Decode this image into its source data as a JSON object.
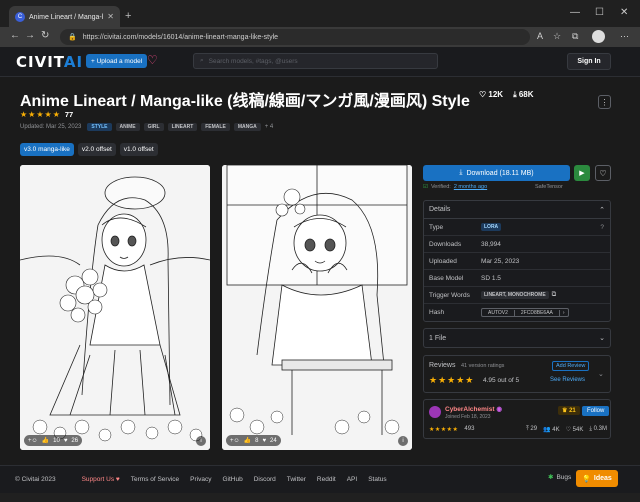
{
  "browser": {
    "tab_title": "Anime Lineart / Manga-like (线稿",
    "url": "https://civitai.com/models/16014/anime-lineart-manga-like-style"
  },
  "site": {
    "logo_main": "CIVIT",
    "logo_ai": "AI",
    "upload_label": "+ Upload a model",
    "search_placeholder": "Search models, #tags, @users",
    "signin_label": "Sign In"
  },
  "model": {
    "title": "Anime Lineart / Manga-like (线稿/線画/マンガ風/漫画风) Style",
    "likes": "12K",
    "downloads_top": "68K",
    "rating_stars": "★★★★★",
    "rating_count": "77",
    "updated": "Updated: Mar 25, 2023",
    "tags": [
      "STYLE",
      "ANIME",
      "GIRL",
      "LINEART",
      "FEMALE",
      "MANGA"
    ],
    "tags_more": "+ 4",
    "versions": [
      "v3.0 manga-like",
      "v2.0 offset",
      "v1.0 offset"
    ]
  },
  "images": [
    {
      "reactions_a": "10",
      "reactions_b": "26"
    },
    {
      "reactions_a": "8",
      "reactions_b": "24"
    }
  ],
  "actions": {
    "download_label": "Download (18.11 MB)",
    "verified_prefix": "Verified:",
    "verified_link": "2 months ago",
    "safetensor": "SafeTensor"
  },
  "details": {
    "header": "Details",
    "rows": {
      "type_label": "Type",
      "type_value": "LORA",
      "downloads_label": "Downloads",
      "downloads_value": "38,994",
      "uploaded_label": "Uploaded",
      "uploaded_value": "Mar 25, 2023",
      "base_label": "Base Model",
      "base_value": "SD 1.5",
      "trigger_label": "Trigger Words",
      "trigger_value": "LINEART, MONOCHROME",
      "hash_label": "Hash",
      "hash_algo": "AUTOV2",
      "hash_value": "2FCD8BE6AA"
    }
  },
  "files": {
    "label": "1 File"
  },
  "reviews": {
    "title": "Reviews",
    "count": "41 version ratings",
    "stars": "★★★★★",
    "score": "4.95 out of 5",
    "add": "Add Review",
    "see": "See Reviews"
  },
  "creator": {
    "name": "CyberAlchemist",
    "joined": "Joined Feb 18, 2023",
    "rank": "21",
    "follow": "Follow",
    "stars": "★★★★★",
    "rating_count": "493",
    "uploads": "29",
    "followers": "4K",
    "likes": "54K",
    "downloads": "0.3M"
  },
  "footer": {
    "copyright": "© Civitai 2023",
    "links": [
      "Support Us ♥",
      "Terms of Service",
      "Privacy",
      "GitHub",
      "Discord",
      "Twitter",
      "Reddit",
      "API",
      "Status"
    ],
    "bugs": "Bugs",
    "ideas": "Ideas"
  },
  "colors": {
    "accent": "#1971c2",
    "star": "#fab005",
    "background": "#1a1b1e"
  }
}
